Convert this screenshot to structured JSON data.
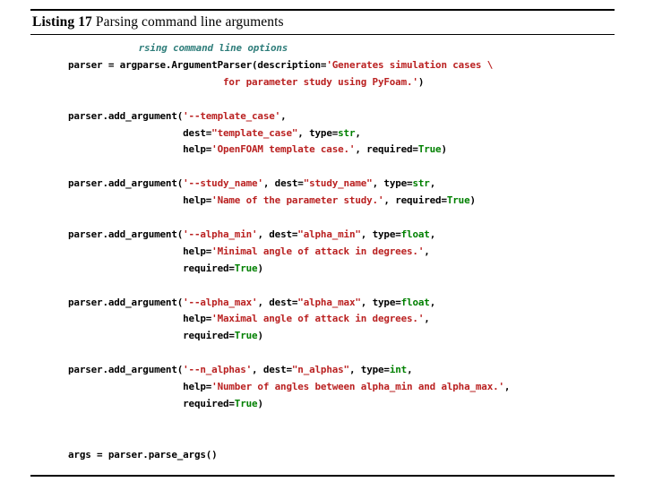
{
  "caption": {
    "label": "Listing 17",
    "text": "Parsing command line arguments"
  },
  "code": {
    "language": "python",
    "colors": {
      "comment": "#2e7d7a",
      "string": "#ba2121",
      "builtin": "#008000",
      "keyword_constant": "#008000",
      "text": "#000000",
      "background": "#ffffff",
      "rule": "#000000"
    },
    "lines": [
      {
        "indent": 12,
        "tokens": [
          {
            "t": "rsing command line options",
            "c": "c"
          }
        ]
      },
      {
        "indent": 0,
        "tokens": [
          {
            "t": "parser = argparse.ArgumentParser(description=",
            "c": "n"
          },
          {
            "t": "'Generates simulation cases \\",
            "c": "s"
          }
        ]
      },
      {
        "indent": 0,
        "tokens": [
          {
            "t": "                           for parameter study using PyFoam.'",
            "c": "s"
          },
          {
            "t": ")",
            "c": "n"
          }
        ]
      },
      {
        "indent": 0,
        "blank": true,
        "tokens": []
      },
      {
        "indent": 0,
        "tokens": [
          {
            "t": "parser.add_argument(",
            "c": "n"
          },
          {
            "t": "'--template_case'",
            "c": "s"
          },
          {
            "t": ",",
            "c": "n"
          }
        ]
      },
      {
        "indent": 0,
        "tokens": [
          {
            "t": "                    dest=",
            "c": "n"
          },
          {
            "t": "\"template_case\"",
            "c": "s"
          },
          {
            "t": ", type=",
            "c": "n"
          },
          {
            "t": "str",
            "c": "nb"
          },
          {
            "t": ",",
            "c": "n"
          }
        ]
      },
      {
        "indent": 0,
        "tokens": [
          {
            "t": "                    help=",
            "c": "n"
          },
          {
            "t": "'OpenFOAM template case.'",
            "c": "s"
          },
          {
            "t": ", required=",
            "c": "n"
          },
          {
            "t": "True",
            "c": "kc"
          },
          {
            "t": ")",
            "c": "n"
          }
        ]
      },
      {
        "indent": 0,
        "blank": true,
        "tokens": []
      },
      {
        "indent": 0,
        "tokens": [
          {
            "t": "parser.add_argument(",
            "c": "n"
          },
          {
            "t": "'--study_name'",
            "c": "s"
          },
          {
            "t": ", dest=",
            "c": "n"
          },
          {
            "t": "\"study_name\"",
            "c": "s"
          },
          {
            "t": ", type=",
            "c": "n"
          },
          {
            "t": "str",
            "c": "nb"
          },
          {
            "t": ",",
            "c": "n"
          }
        ]
      },
      {
        "indent": 0,
        "tokens": [
          {
            "t": "                    help=",
            "c": "n"
          },
          {
            "t": "'Name of the parameter study.'",
            "c": "s"
          },
          {
            "t": ", required=",
            "c": "n"
          },
          {
            "t": "True",
            "c": "kc"
          },
          {
            "t": ")",
            "c": "n"
          }
        ]
      },
      {
        "indent": 0,
        "blank": true,
        "tokens": []
      },
      {
        "indent": 0,
        "tokens": [
          {
            "t": "parser.add_argument(",
            "c": "n"
          },
          {
            "t": "'--alpha_min'",
            "c": "s"
          },
          {
            "t": ", dest=",
            "c": "n"
          },
          {
            "t": "\"alpha_min\"",
            "c": "s"
          },
          {
            "t": ", type=",
            "c": "n"
          },
          {
            "t": "float",
            "c": "nb"
          },
          {
            "t": ",",
            "c": "n"
          }
        ]
      },
      {
        "indent": 0,
        "tokens": [
          {
            "t": "                    help=",
            "c": "n"
          },
          {
            "t": "'Minimal angle of attack in degrees.'",
            "c": "s"
          },
          {
            "t": ",",
            "c": "n"
          }
        ]
      },
      {
        "indent": 0,
        "tokens": [
          {
            "t": "                    required=",
            "c": "n"
          },
          {
            "t": "True",
            "c": "kc"
          },
          {
            "t": ")",
            "c": "n"
          }
        ]
      },
      {
        "indent": 0,
        "blank": true,
        "tokens": []
      },
      {
        "indent": 0,
        "tokens": [
          {
            "t": "parser.add_argument(",
            "c": "n"
          },
          {
            "t": "'--alpha_max'",
            "c": "s"
          },
          {
            "t": ", dest=",
            "c": "n"
          },
          {
            "t": "\"alpha_max\"",
            "c": "s"
          },
          {
            "t": ", type=",
            "c": "n"
          },
          {
            "t": "float",
            "c": "nb"
          },
          {
            "t": ",",
            "c": "n"
          }
        ]
      },
      {
        "indent": 0,
        "tokens": [
          {
            "t": "                    help=",
            "c": "n"
          },
          {
            "t": "'Maximal angle of attack in degrees.'",
            "c": "s"
          },
          {
            "t": ",",
            "c": "n"
          }
        ]
      },
      {
        "indent": 0,
        "tokens": [
          {
            "t": "                    required=",
            "c": "n"
          },
          {
            "t": "True",
            "c": "kc"
          },
          {
            "t": ")",
            "c": "n"
          }
        ]
      },
      {
        "indent": 0,
        "blank": true,
        "tokens": []
      },
      {
        "indent": 0,
        "tokens": [
          {
            "t": "parser.add_argument(",
            "c": "n"
          },
          {
            "t": "'--n_alphas'",
            "c": "s"
          },
          {
            "t": ", dest=",
            "c": "n"
          },
          {
            "t": "\"n_alphas\"",
            "c": "s"
          },
          {
            "t": ", type=",
            "c": "n"
          },
          {
            "t": "int",
            "c": "nb"
          },
          {
            "t": ",",
            "c": "n"
          }
        ]
      },
      {
        "indent": 0,
        "tokens": [
          {
            "t": "                    help=",
            "c": "n"
          },
          {
            "t": "'Number of angles between alpha_min and alpha_max.'",
            "c": "s"
          },
          {
            "t": ",",
            "c": "n"
          }
        ]
      },
      {
        "indent": 0,
        "tokens": [
          {
            "t": "                    required=",
            "c": "n"
          },
          {
            "t": "True",
            "c": "kc"
          },
          {
            "t": ")",
            "c": "n"
          }
        ]
      },
      {
        "indent": 0,
        "blank": true,
        "tokens": []
      },
      {
        "indent": 0,
        "blank": true,
        "tokens": []
      },
      {
        "indent": 0,
        "tokens": [
          {
            "t": "args = parser.parse_args()",
            "c": "n"
          }
        ]
      }
    ]
  }
}
